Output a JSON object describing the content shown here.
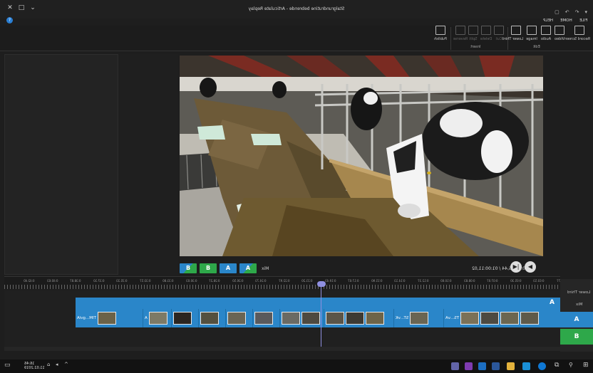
{
  "window": {
    "title": "Stalgrundrutine bebrende - Articulate Replay",
    "close_glyph": "✕",
    "maximize_glyph": "□",
    "minimize_glyph": "⌄",
    "help_glyph": "?"
  },
  "quick_access": [
    "▢",
    "↶",
    "↷",
    "▾"
  ],
  "menu_tabs": [
    "FILE",
    "HOME",
    "HELP"
  ],
  "ribbon": {
    "insert_group_label": "Insert",
    "edit_group_label": "Edit",
    "insert_buttons": [
      "Record Screen",
      "Video",
      "Audio",
      "Image",
      "Lower Third"
    ],
    "edit_buttons": [
      "Cut",
      "Delete",
      "Split",
      "Reverse"
    ],
    "publish_label": "Publish"
  },
  "video": {
    "mix_label": "Mix",
    "timecode": "00:03:36,44 / 01:00:11,02",
    "sequence_buttons": [
      {
        "label": "B",
        "style": "mix"
      },
      {
        "label": "B",
        "style": "green"
      },
      {
        "label": "A",
        "style": "blue"
      },
      {
        "label": "A",
        "style": "mix"
      }
    ],
    "prev_glyph": "◀",
    "next_glyph": "▶|"
  },
  "ruler_labels": [
    "0:01.77",
    "0:03.53",
    "0:05.30",
    "0:07.07",
    "0:08.83",
    "0:10.60",
    "0:12.37",
    "0:14.13",
    "0:15.90",
    "0:17.67",
    "0:19.43",
    "0:21.20",
    "0:22.97",
    "0:24.73",
    "0:26.50",
    "0:28.27",
    "0:30.03",
    "0:31.80",
    "0:33.57",
    "0:35.33",
    "0:37.10",
    "0:38.87",
    "0:40.63",
    "0:42.40"
  ],
  "tracks": {
    "a_label": "A",
    "clips": [
      {
        "label": "TIM...gviA"
      },
      {
        "label": "A"
      },
      {
        "label": ""
      },
      {
        "label": ""
      },
      {
        "label": ""
      },
      {
        "label": ""
      },
      {
        "label": ""
      },
      {
        "label": "ST...vK"
      },
      {
        "label": "TS...vA"
      },
      {
        "label": ""
      }
    ]
  },
  "right_sidebar": {
    "lower_third_label": "Lower Third",
    "mix_label": "Mix",
    "a_label": "A",
    "b_label": "B"
  },
  "zoom_label": "— ▲ —+",
  "taskbar": {
    "clock_time": "16:46",
    "clock_date": "11.02.2019",
    "search_glyph": "🔍",
    "icons": [
      "teams",
      "onenote",
      "outlook",
      "word",
      "explorer",
      "edge",
      "store"
    ]
  },
  "colors": {
    "track_blue": "#2a86c9",
    "track_green": "#2ea84a",
    "playhead": "#8f8fe0"
  }
}
